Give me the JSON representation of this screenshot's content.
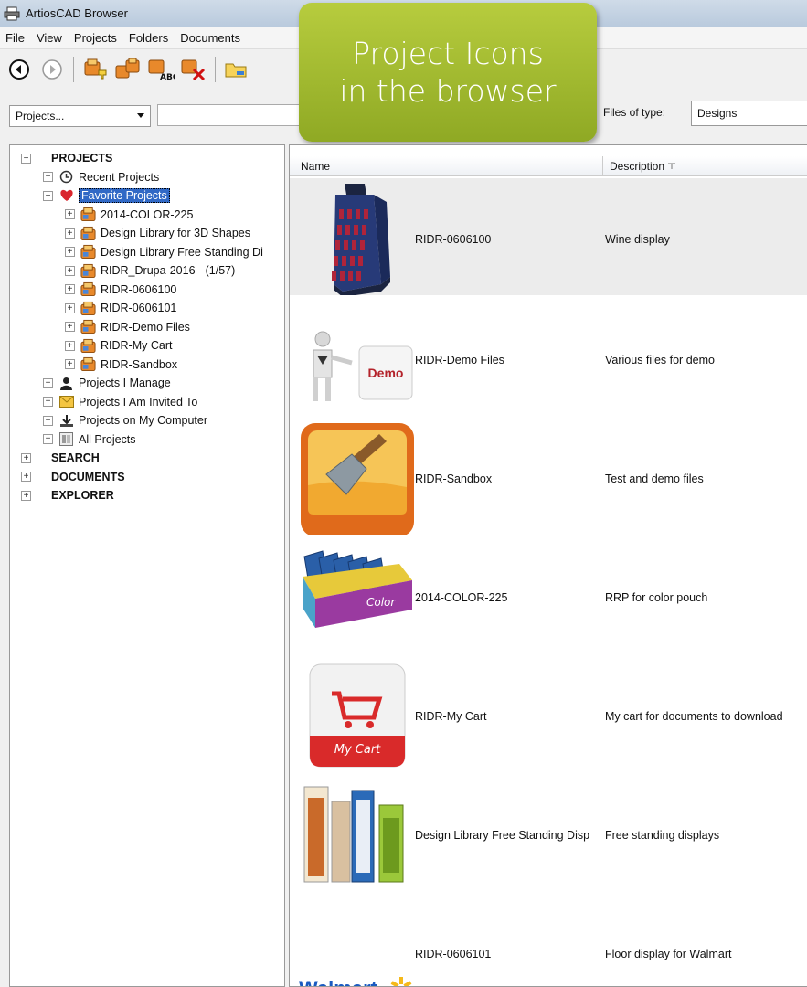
{
  "window": {
    "title": "ArtiosCAD Browser"
  },
  "menu": [
    "File",
    "View",
    "Projects",
    "Folders",
    "Documents"
  ],
  "toolbar": {
    "buttons": [
      "back-icon",
      "forward-icon",
      "new-project-icon",
      "copy-project-icon",
      "rename-project-icon",
      "delete-project-icon",
      "new-folder-icon"
    ]
  },
  "filter": {
    "scope": "Projects...",
    "search_value": "",
    "filetype_label": "Files of type:",
    "filetype_value": "Designs"
  },
  "callout": {
    "line1": "Project Icons",
    "line2": "in the browser"
  },
  "tree": [
    {
      "label": "PROJECTS",
      "level": 0,
      "expander": "−",
      "bold": true
    },
    {
      "label": "Recent Projects",
      "level": 1,
      "expander": "+",
      "icon": "clock-icon"
    },
    {
      "label": "Favorite Projects",
      "level": 1,
      "expander": "−",
      "icon": "heart-icon",
      "selected": true
    },
    {
      "label": "2014-COLOR-225",
      "level": 2,
      "expander": "+",
      "icon": "project-icon"
    },
    {
      "label": "Design Library for 3D Shapes",
      "level": 2,
      "expander": "+",
      "icon": "project-icon"
    },
    {
      "label": "Design Library Free Standing Di",
      "level": 2,
      "expander": "+",
      "icon": "project-icon"
    },
    {
      "label": "RIDR_Drupa-2016 - (1/57)",
      "level": 2,
      "expander": "+",
      "icon": "project-icon"
    },
    {
      "label": "RIDR-0606100",
      "level": 2,
      "expander": "+",
      "icon": "project-icon"
    },
    {
      "label": "RIDR-0606101",
      "level": 2,
      "expander": "+",
      "icon": "project-icon"
    },
    {
      "label": "RIDR-Demo Files",
      "level": 2,
      "expander": "+",
      "icon": "project-icon"
    },
    {
      "label": "RIDR-My Cart",
      "level": 2,
      "expander": "+",
      "icon": "project-icon"
    },
    {
      "label": "RIDR-Sandbox",
      "level": 2,
      "expander": "+",
      "icon": "project-icon"
    },
    {
      "label": "Projects I Manage",
      "level": 1,
      "expander": "+",
      "icon": "user-icon"
    },
    {
      "label": "Projects I Am Invited To",
      "level": 1,
      "expander": "+",
      "icon": "envelope-icon"
    },
    {
      "label": "Projects on My Computer",
      "level": 1,
      "expander": "+",
      "icon": "download-icon"
    },
    {
      "label": "All Projects",
      "level": 1,
      "expander": "+",
      "icon": "list-icon"
    },
    {
      "label": "SEARCH",
      "level": 0,
      "expander": "+",
      "bold": true
    },
    {
      "label": "DOCUMENTS",
      "level": 0,
      "expander": "+",
      "bold": true
    },
    {
      "label": "EXPLORER",
      "level": 0,
      "expander": "+",
      "bold": true
    }
  ],
  "list": {
    "columns": {
      "name": "Name",
      "description": "Description"
    },
    "rows": [
      {
        "name": "RIDR-0606100",
        "description": "Wine display",
        "thumb": "wine-display-thumb"
      },
      {
        "name": "RIDR-Demo Files",
        "description": "Various files for demo",
        "thumb": "demo-thumb",
        "thumb_text": "Demo"
      },
      {
        "name": "RIDR-Sandbox",
        "description": "Test and demo files",
        "thumb": "sandbox-thumb"
      },
      {
        "name": "2014-COLOR-225",
        "description": "RRP for color pouch",
        "thumb": "color-pouch-thumb",
        "thumb_text": "Color"
      },
      {
        "name": "RIDR-My Cart",
        "description": "My cart for documents to download",
        "thumb": "cart-thumb",
        "thumb_text": "My Cart"
      },
      {
        "name": "Design Library Free Standing Disp",
        "description": "Free standing displays",
        "thumb": "free-standing-thumb"
      },
      {
        "name": "RIDR-0606101",
        "description": "Floor display for Walmart",
        "thumb": "walmart-thumb",
        "thumb_text": "Walmart"
      }
    ]
  },
  "colors": {
    "callout": "#a4bd32",
    "selection": "#3169c6"
  }
}
